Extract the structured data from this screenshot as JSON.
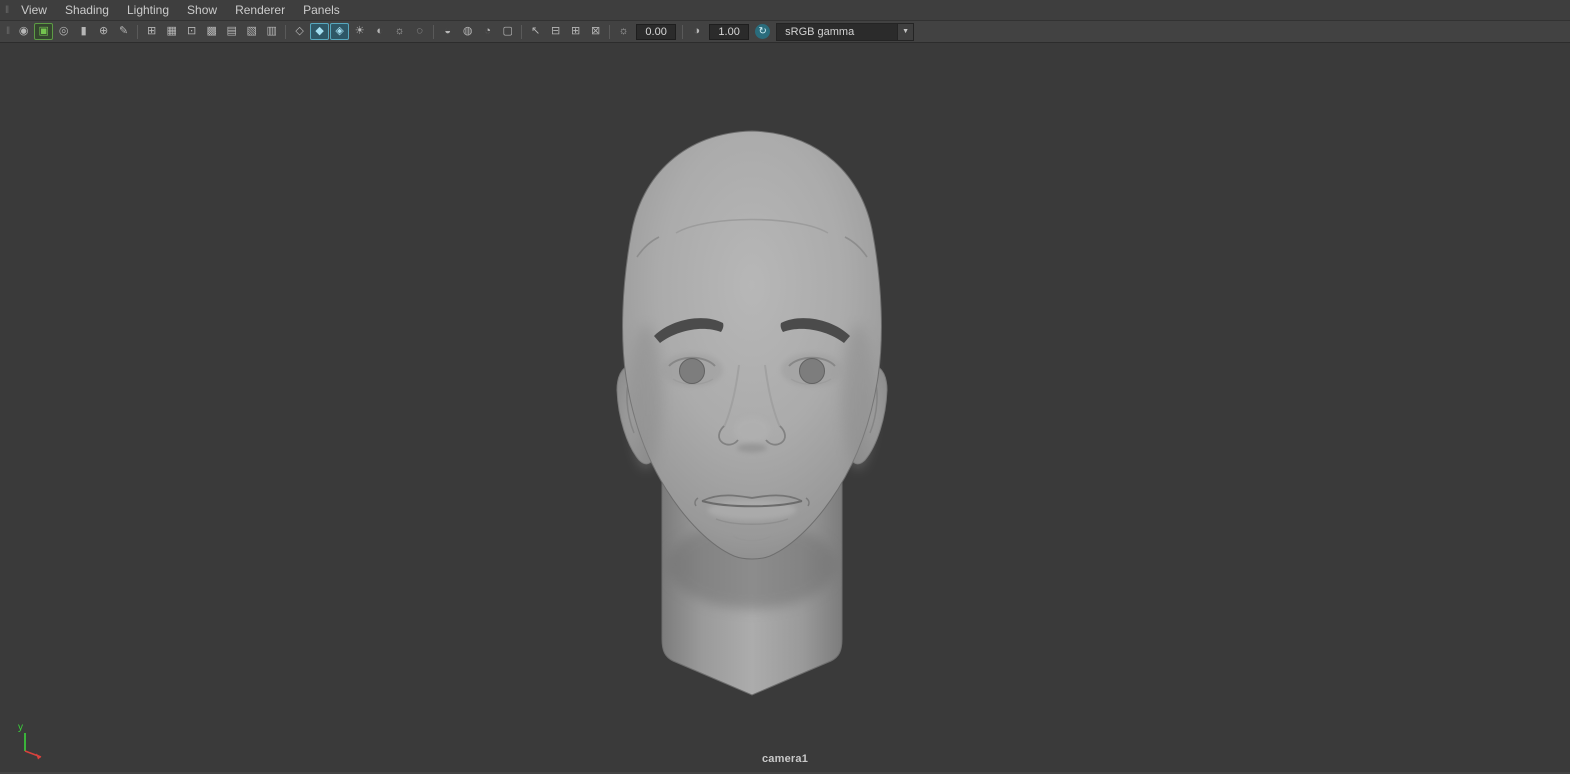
{
  "menu_bar": {
    "items": [
      {
        "label": "View"
      },
      {
        "label": "Shading"
      },
      {
        "label": "Lighting"
      },
      {
        "label": "Show"
      },
      {
        "label": "Renderer"
      },
      {
        "label": "Panels"
      }
    ]
  },
  "toolbar": {
    "items": [
      {
        "type": "icon",
        "name": "select-camera-icon",
        "glyph": "◉"
      },
      {
        "type": "icon",
        "name": "image-plane-icon",
        "glyph": "▣",
        "state": "active-green"
      },
      {
        "type": "icon",
        "name": "camera-attributes-icon",
        "glyph": "◎"
      },
      {
        "type": "icon",
        "name": "bookmark-icon",
        "glyph": "▮"
      },
      {
        "type": "icon",
        "name": "pan-zoom-icon",
        "glyph": "⊕"
      },
      {
        "type": "icon",
        "name": "grease-pencil-icon",
        "glyph": "✎"
      },
      {
        "type": "separator"
      },
      {
        "type": "icon",
        "name": "grid-icon",
        "glyph": "⊞"
      },
      {
        "type": "icon",
        "name": "film-gate-icon",
        "glyph": "▦"
      },
      {
        "type": "icon",
        "name": "resolution-gate-icon",
        "glyph": "⊡"
      },
      {
        "type": "icon",
        "name": "gate-mask-icon",
        "glyph": "▩"
      },
      {
        "type": "icon",
        "name": "field-chart-icon",
        "glyph": "▤"
      },
      {
        "type": "icon",
        "name": "safe-action-icon",
        "glyph": "▧"
      },
      {
        "type": "icon",
        "name": "safe-title-icon",
        "glyph": "▥"
      },
      {
        "type": "separator"
      },
      {
        "type": "icon",
        "name": "wireframe-icon",
        "glyph": "◇"
      },
      {
        "type": "icon",
        "name": "smooth-shade-icon",
        "glyph": "◆",
        "state": "active"
      },
      {
        "type": "icon",
        "name": "textured-icon",
        "glyph": "◈",
        "state": "active"
      },
      {
        "type": "icon",
        "name": "use-all-lights-icon",
        "glyph": "☀"
      },
      {
        "type": "icon",
        "name": "shadows-icon",
        "glyph": "◐"
      },
      {
        "type": "icon",
        "name": "screen-space-ao-icon",
        "glyph": "☼"
      },
      {
        "type": "icon",
        "name": "motion-blur-icon",
        "glyph": "◌"
      },
      {
        "type": "separator"
      },
      {
        "type": "icon",
        "name": "isolate-select-icon",
        "glyph": "◒"
      },
      {
        "type": "icon",
        "name": "xray-icon",
        "glyph": "◍"
      },
      {
        "type": "icon",
        "name": "xray-joints-icon",
        "glyph": "◔"
      },
      {
        "type": "icon",
        "name": "wireframe-on-shaded-icon",
        "glyph": "▢"
      },
      {
        "type": "separator"
      },
      {
        "type": "icon",
        "name": "select-tool-icon",
        "glyph": "↖"
      },
      {
        "type": "icon",
        "name": "tear-off-copy-icon",
        "glyph": "⊟"
      },
      {
        "type": "icon",
        "name": "tear-off-icon",
        "glyph": "⊞"
      },
      {
        "type": "icon",
        "name": "snapshot-icon",
        "glyph": "⊠"
      },
      {
        "type": "separator"
      },
      {
        "type": "icon",
        "name": "exposure-icon",
        "glyph": "☼"
      },
      {
        "type": "field",
        "name": "exposure-field",
        "value": "0.00"
      },
      {
        "type": "separator"
      },
      {
        "type": "icon",
        "name": "gamma-icon",
        "glyph": "◑"
      },
      {
        "type": "field",
        "name": "gamma-field",
        "value": "1.00"
      },
      {
        "type": "icon",
        "name": "color-management-icon",
        "glyph": "↻",
        "state": "round-teal"
      },
      {
        "type": "dropdown",
        "name": "view-transform-dropdown",
        "value": "sRGB gamma"
      }
    ]
  },
  "viewport": {
    "camera_label": "camera1",
    "axis_gizmo": {
      "y_label": "y"
    }
  },
  "colors": {
    "viewport_bg": "#3a3a3a",
    "menubar_bg": "#3e3e3e",
    "toolbar_bg": "#424242",
    "icon_active_teal": "#2e5766",
    "icon_active_green": "#74c44f",
    "field_bg": "#2b2b2b",
    "model_gray": "#a8a8a8",
    "axis_y_green": "#3bd23b",
    "axis_x_red": "#d8413c"
  }
}
